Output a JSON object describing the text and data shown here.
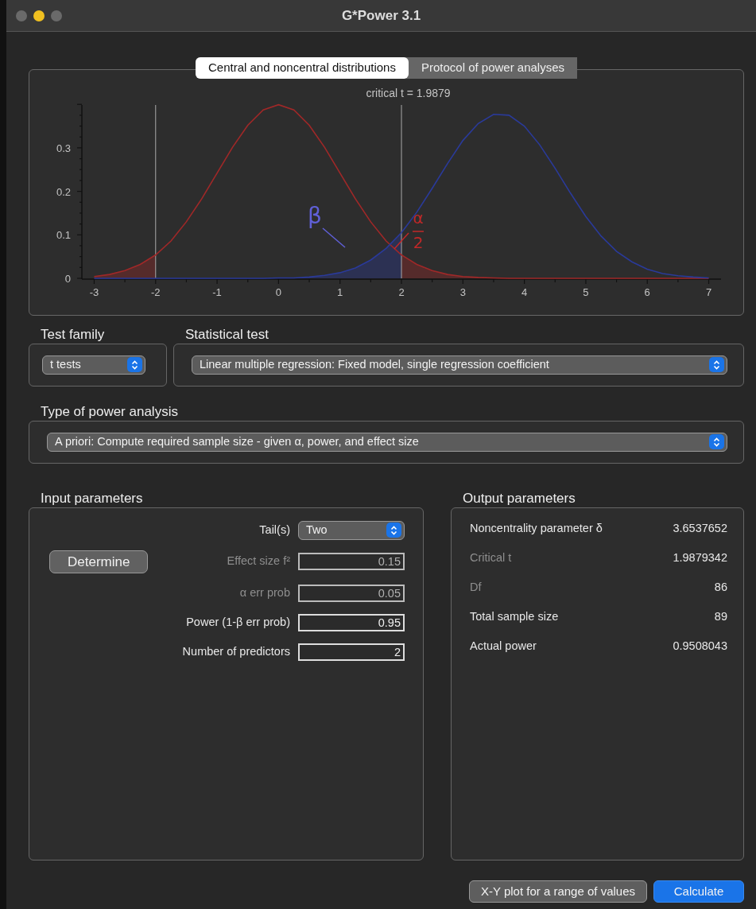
{
  "window": {
    "title": "G*Power 3.1"
  },
  "tabs": [
    {
      "label": "Central and noncentral distributions",
      "selected": true
    },
    {
      "label": "Protocol of power analyses",
      "selected": false
    }
  ],
  "chart": {
    "chart_data": {
      "type": "line",
      "title": "critical t = 1.9879",
      "x": [
        -3,
        -2.75,
        -2.5,
        -2.25,
        -2,
        -1.75,
        -1.5,
        -1.25,
        -1,
        -0.75,
        -0.5,
        -0.25,
        0,
        0.25,
        0.5,
        0.75,
        1,
        1.25,
        1.5,
        1.75,
        2,
        2.25,
        2.5,
        2.75,
        3,
        3.25,
        3.5,
        3.75,
        4,
        4.25,
        4.5,
        4.75,
        5,
        5.25,
        5.5,
        5.75,
        6,
        6.25,
        6.5,
        6.75,
        7
      ],
      "xlim": [
        -3.2,
        7.2
      ],
      "ylim": [
        0,
        0.4
      ],
      "xticks": [
        -3,
        -2,
        -1,
        0,
        1,
        2,
        3,
        4,
        5,
        6,
        7
      ],
      "yticks": [
        0,
        0.1,
        0.2,
        0.3
      ],
      "series": [
        {
          "color": "#a02828",
          "values": [
            0.004,
            0.009,
            0.018,
            0.032,
            0.054,
            0.086,
            0.13,
            0.183,
            0.242,
            0.301,
            0.352,
            0.387,
            0.399,
            0.387,
            0.352,
            0.301,
            0.242,
            0.183,
            0.13,
            0.086,
            0.054,
            0.032,
            0.018,
            0.009,
            0.004,
            0.002,
            0.001,
            0,
            0,
            0,
            0,
            0,
            0,
            0,
            0,
            0,
            0,
            0,
            0,
            0,
            0
          ]
        },
        {
          "color": "#2a3a9a",
          "values": [
            0,
            0,
            0,
            0,
            0,
            0,
            0,
            0,
            0,
            0,
            0,
            0,
            0.001,
            0.001,
            0.003,
            0.007,
            0.013,
            0.024,
            0.042,
            0.069,
            0.105,
            0.152,
            0.207,
            0.264,
            0.317,
            0.356,
            0.377,
            0.375,
            0.35,
            0.307,
            0.253,
            0.196,
            0.142,
            0.097,
            0.062,
            0.038,
            0.021,
            0.011,
            0.006,
            0.003,
            0.001
          ]
        }
      ],
      "ref_lines": [
        {
          "axis": "x",
          "value": -2
        },
        {
          "axis": "x",
          "value": 2
        }
      ],
      "annotations": [
        "β",
        "α",
        "2"
      ]
    }
  },
  "test_family": {
    "label": "Test family",
    "value": "t tests"
  },
  "statistical_test": {
    "label": "Statistical test",
    "value": "Linear multiple regression: Fixed model, single regression coefficient"
  },
  "power_analysis_type": {
    "label": "Type of power analysis",
    "value": "A priori: Compute required sample size - given α, power, and effect size"
  },
  "input_parameters": {
    "title": "Input parameters",
    "determine_button": "Determine",
    "rows": [
      {
        "kind": "select",
        "label": "Tail(s)",
        "value": "Two",
        "disabled": false
      },
      {
        "kind": "field",
        "label": "Effect size f²",
        "value": "0.15",
        "disabled": true
      },
      {
        "kind": "field",
        "label": "α err prob",
        "value": "0.05",
        "disabled": true
      },
      {
        "kind": "field",
        "label": "Power (1-β err prob)",
        "value": "0.95",
        "disabled": false
      },
      {
        "kind": "field",
        "label": "Number of predictors",
        "value": "2",
        "disabled": false
      }
    ]
  },
  "output_parameters": {
    "title": "Output parameters",
    "rows": [
      {
        "label": "Noncentrality parameter δ",
        "value": "3.6537652",
        "disabled": false
      },
      {
        "label": "Critical t",
        "value": "1.9879342",
        "disabled": true
      },
      {
        "label": "Df",
        "value": "86",
        "disabled": true
      },
      {
        "label": "Total sample size",
        "value": "89",
        "disabled": false
      },
      {
        "label": "Actual power",
        "value": "0.9508043",
        "disabled": false
      }
    ]
  },
  "buttons": [
    {
      "label": "X-Y plot for a range of values",
      "kind": "secondary"
    },
    {
      "label": "Calculate",
      "kind": "primary"
    }
  ]
}
